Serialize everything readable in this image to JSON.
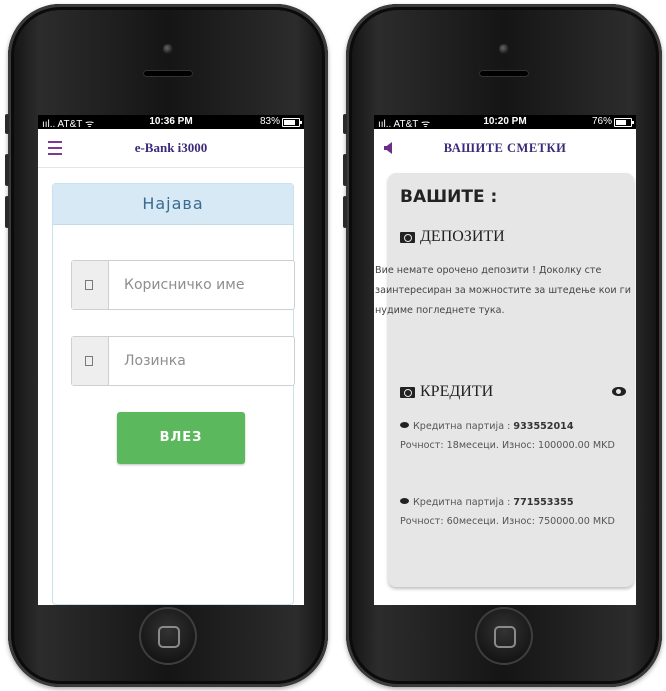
{
  "left_phone": {
    "status": {
      "carrier": "ııl.. AT&T ᯤ",
      "time": "10:36 PM",
      "battery": "83%",
      "battery_level": 0.83
    },
    "navbar": {
      "title": "e-Bank i3000"
    },
    "login": {
      "header": "Најава",
      "username_placeholder": "Корисничко име",
      "password_placeholder": "Лозинка",
      "submit_label": "ВЛЕЗ"
    }
  },
  "right_phone": {
    "status": {
      "carrier": "ııl.. AT&T ᯤ",
      "time": "10:20 PM",
      "battery": "76%",
      "battery_level": 0.76
    },
    "navbar": {
      "title": "ВАШИТЕ СМЕТКИ"
    },
    "content": {
      "heading": "ВАШИТЕ :",
      "deposits": {
        "title": "ДЕПОЗИТИ",
        "note": "Вие немате орочено депозити ! Доколку сте заинтересиран за можностите за штедење кои ги нудиме погледнете тука."
      },
      "credits": {
        "title": "КРЕДИТИ",
        "items": [
          {
            "label": "Кредитна партија :",
            "number": "933552014",
            "details": "Рочност: 18месеци. Износ: 100000.00 MKD"
          },
          {
            "label": "Кредитна партија :",
            "number": "771553355",
            "details": "Рочност: 60месеци. Износ: 750000.00 MKD"
          }
        ]
      }
    }
  },
  "icons": [
    "menu-icon",
    "back-arrow-icon",
    "money-icon",
    "eye-icon",
    "lock-icon",
    "user-icon"
  ]
}
